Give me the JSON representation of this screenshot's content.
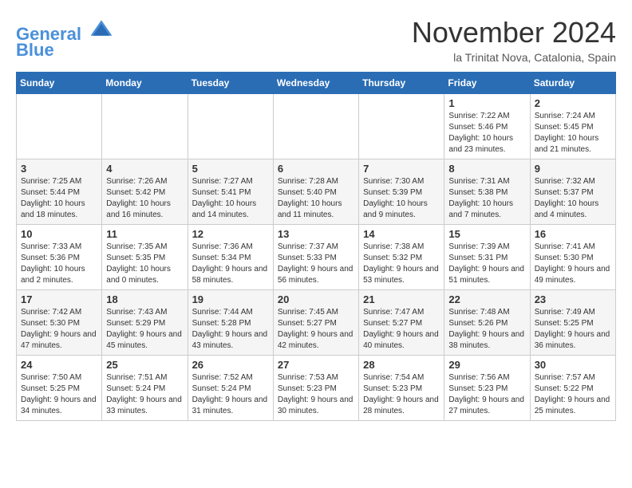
{
  "logo": {
    "line1": "General",
    "line2": "Blue"
  },
  "title": "November 2024",
  "location": "la Trinitat Nova, Catalonia, Spain",
  "days_of_week": [
    "Sunday",
    "Monday",
    "Tuesday",
    "Wednesday",
    "Thursday",
    "Friday",
    "Saturday"
  ],
  "weeks": [
    [
      {
        "day": "",
        "info": ""
      },
      {
        "day": "",
        "info": ""
      },
      {
        "day": "",
        "info": ""
      },
      {
        "day": "",
        "info": ""
      },
      {
        "day": "",
        "info": ""
      },
      {
        "day": "1",
        "info": "Sunrise: 7:22 AM\nSunset: 5:46 PM\nDaylight: 10 hours and 23 minutes."
      },
      {
        "day": "2",
        "info": "Sunrise: 7:24 AM\nSunset: 5:45 PM\nDaylight: 10 hours and 21 minutes."
      }
    ],
    [
      {
        "day": "3",
        "info": "Sunrise: 7:25 AM\nSunset: 5:44 PM\nDaylight: 10 hours and 18 minutes."
      },
      {
        "day": "4",
        "info": "Sunrise: 7:26 AM\nSunset: 5:42 PM\nDaylight: 10 hours and 16 minutes."
      },
      {
        "day": "5",
        "info": "Sunrise: 7:27 AM\nSunset: 5:41 PM\nDaylight: 10 hours and 14 minutes."
      },
      {
        "day": "6",
        "info": "Sunrise: 7:28 AM\nSunset: 5:40 PM\nDaylight: 10 hours and 11 minutes."
      },
      {
        "day": "7",
        "info": "Sunrise: 7:30 AM\nSunset: 5:39 PM\nDaylight: 10 hours and 9 minutes."
      },
      {
        "day": "8",
        "info": "Sunrise: 7:31 AM\nSunset: 5:38 PM\nDaylight: 10 hours and 7 minutes."
      },
      {
        "day": "9",
        "info": "Sunrise: 7:32 AM\nSunset: 5:37 PM\nDaylight: 10 hours and 4 minutes."
      }
    ],
    [
      {
        "day": "10",
        "info": "Sunrise: 7:33 AM\nSunset: 5:36 PM\nDaylight: 10 hours and 2 minutes."
      },
      {
        "day": "11",
        "info": "Sunrise: 7:35 AM\nSunset: 5:35 PM\nDaylight: 10 hours and 0 minutes."
      },
      {
        "day": "12",
        "info": "Sunrise: 7:36 AM\nSunset: 5:34 PM\nDaylight: 9 hours and 58 minutes."
      },
      {
        "day": "13",
        "info": "Sunrise: 7:37 AM\nSunset: 5:33 PM\nDaylight: 9 hours and 56 minutes."
      },
      {
        "day": "14",
        "info": "Sunrise: 7:38 AM\nSunset: 5:32 PM\nDaylight: 9 hours and 53 minutes."
      },
      {
        "day": "15",
        "info": "Sunrise: 7:39 AM\nSunset: 5:31 PM\nDaylight: 9 hours and 51 minutes."
      },
      {
        "day": "16",
        "info": "Sunrise: 7:41 AM\nSunset: 5:30 PM\nDaylight: 9 hours and 49 minutes."
      }
    ],
    [
      {
        "day": "17",
        "info": "Sunrise: 7:42 AM\nSunset: 5:30 PM\nDaylight: 9 hours and 47 minutes."
      },
      {
        "day": "18",
        "info": "Sunrise: 7:43 AM\nSunset: 5:29 PM\nDaylight: 9 hours and 45 minutes."
      },
      {
        "day": "19",
        "info": "Sunrise: 7:44 AM\nSunset: 5:28 PM\nDaylight: 9 hours and 43 minutes."
      },
      {
        "day": "20",
        "info": "Sunrise: 7:45 AM\nSunset: 5:27 PM\nDaylight: 9 hours and 42 minutes."
      },
      {
        "day": "21",
        "info": "Sunrise: 7:47 AM\nSunset: 5:27 PM\nDaylight: 9 hours and 40 minutes."
      },
      {
        "day": "22",
        "info": "Sunrise: 7:48 AM\nSunset: 5:26 PM\nDaylight: 9 hours and 38 minutes."
      },
      {
        "day": "23",
        "info": "Sunrise: 7:49 AM\nSunset: 5:25 PM\nDaylight: 9 hours and 36 minutes."
      }
    ],
    [
      {
        "day": "24",
        "info": "Sunrise: 7:50 AM\nSunset: 5:25 PM\nDaylight: 9 hours and 34 minutes."
      },
      {
        "day": "25",
        "info": "Sunrise: 7:51 AM\nSunset: 5:24 PM\nDaylight: 9 hours and 33 minutes."
      },
      {
        "day": "26",
        "info": "Sunrise: 7:52 AM\nSunset: 5:24 PM\nDaylight: 9 hours and 31 minutes."
      },
      {
        "day": "27",
        "info": "Sunrise: 7:53 AM\nSunset: 5:23 PM\nDaylight: 9 hours and 30 minutes."
      },
      {
        "day": "28",
        "info": "Sunrise: 7:54 AM\nSunset: 5:23 PM\nDaylight: 9 hours and 28 minutes."
      },
      {
        "day": "29",
        "info": "Sunrise: 7:56 AM\nSunset: 5:23 PM\nDaylight: 9 hours and 27 minutes."
      },
      {
        "day": "30",
        "info": "Sunrise: 7:57 AM\nSunset: 5:22 PM\nDaylight: 9 hours and 25 minutes."
      }
    ]
  ]
}
